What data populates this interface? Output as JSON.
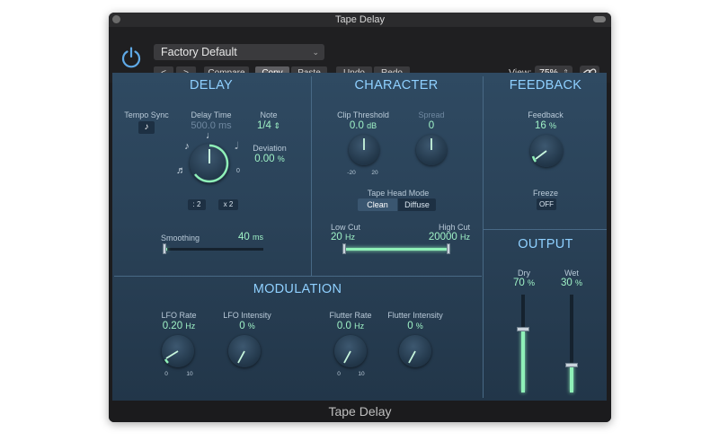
{
  "window": {
    "title": "Tape Delay",
    "footer": "Tape Delay"
  },
  "header": {
    "preset": "Factory Default",
    "buttons": {
      "back": "<",
      "forward": ">",
      "compare": "Compare",
      "copy": "Copy",
      "paste": "Paste",
      "undo": "Undo",
      "redo": "Redo"
    },
    "view_label": "View:",
    "view_value": "75%"
  },
  "delay": {
    "title": "DELAY",
    "tempo_sync_label": "Tempo Sync",
    "delay_time_label": "Delay Time",
    "delay_time_value": "500.0 ms",
    "note_label": "Note",
    "note_value": "1/4",
    "deviation_label": "Deviation",
    "deviation_value": "0.00",
    "deviation_unit": "%",
    "div2_label": ": 2",
    "mul2_label": "x 2",
    "smoothing_label": "Smoothing",
    "smoothing_value": "40",
    "smoothing_unit": "ms",
    "scale_zero": "0"
  },
  "character": {
    "title": "CHARACTER",
    "clip_threshold_label": "Clip Threshold",
    "clip_threshold_value": "0.0",
    "clip_threshold_unit": "dB",
    "clip_min": "-20",
    "clip_max": "20",
    "spread_label": "Spread",
    "spread_value": "0",
    "tape_head_mode_label": "Tape Head Mode",
    "mode_clean": "Clean",
    "mode_diffuse": "Diffuse",
    "low_cut_label": "Low Cut",
    "low_cut_value": "20",
    "low_cut_unit": "Hz",
    "high_cut_label": "High Cut",
    "high_cut_value": "20000",
    "high_cut_unit": "Hz"
  },
  "feedback": {
    "title": "FEEDBACK",
    "feedback_label": "Feedback",
    "feedback_value": "16",
    "feedback_unit": "%",
    "freeze_label": "Freeze",
    "freeze_value": "OFF"
  },
  "output": {
    "title": "OUTPUT",
    "dry_label": "Dry",
    "dry_value": "70",
    "dry_unit": "%",
    "wet_label": "Wet",
    "wet_value": "30",
    "wet_unit": "%"
  },
  "modulation": {
    "title": "MODULATION",
    "lfo_rate_label": "LFO Rate",
    "lfo_rate_value": "0.20",
    "lfo_rate_unit": "Hz",
    "lfo_min": "0",
    "lfo_max": "10",
    "lfo_intensity_label": "LFO Intensity",
    "lfo_intensity_value": "0",
    "lfo_intensity_unit": "%",
    "flutter_rate_label": "Flutter Rate",
    "flutter_rate_value": "0.0",
    "flutter_rate_unit": "Hz",
    "flutter_min": "0",
    "flutter_max": "10",
    "flutter_intensity_label": "Flutter Intensity",
    "flutter_intensity_value": "0",
    "flutter_intensity_unit": "%"
  },
  "colors": {
    "accent": "#8fd0ff",
    "value": "#9ff2c6",
    "panel": "#2a4258"
  }
}
